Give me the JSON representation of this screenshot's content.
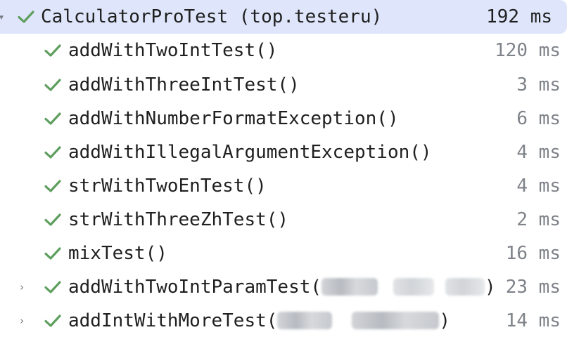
{
  "colors": {
    "selected_row_bg": "#dfe6fb",
    "check_green": "#5e9e5e",
    "text": "#1f1f1f",
    "duration_gray": "#7f8389",
    "arrow_gray": "#777a80"
  },
  "icons": {
    "expand_arrow_open": "chevron-down-icon",
    "expand_arrow_closed": "chevron-right-icon",
    "pass_status": "check-icon"
  },
  "root": {
    "label": "CalculatorProTest (top.testeru)",
    "duration": "192 ms",
    "status": "passed",
    "expanded": true,
    "selected": true
  },
  "tests": [
    {
      "name": "addWithTwoIntTest()",
      "duration": "120 ms",
      "status": "passed"
    },
    {
      "name": "addWithThreeIntTest()",
      "duration": "3 ms",
      "status": "passed"
    },
    {
      "name": "addWithNumberFormatException()",
      "duration": "6 ms",
      "status": "passed"
    },
    {
      "name": "addWithIllegalArgumentException()",
      "duration": "4 ms",
      "status": "passed"
    },
    {
      "name": "strWithTwoEnTest()",
      "duration": "4 ms",
      "status": "passed"
    },
    {
      "name": "strWithThreeZhTest()",
      "duration": "2 ms",
      "status": "passed"
    },
    {
      "name": "mixTest()",
      "duration": "16 ms",
      "status": "passed"
    },
    {
      "name_prefix": "addWithTwoIntParamTest(",
      "name_suffix": ")",
      "duration": "23 ms",
      "status": "passed",
      "expandable": true,
      "expanded": false
    },
    {
      "name_prefix": "addIntWithMoreTest(",
      "name_suffix": ")",
      "duration": "14 ms",
      "status": "passed",
      "expandable": true,
      "expanded": false
    }
  ]
}
